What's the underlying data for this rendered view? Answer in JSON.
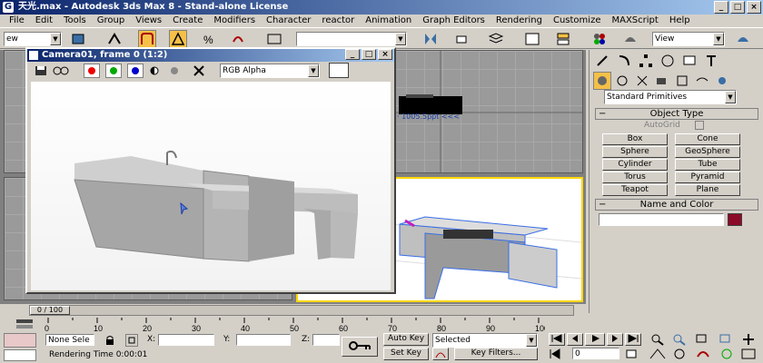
{
  "window": {
    "title": "天光.max - Autodesk 3ds Max 8 - Stand-alone License",
    "min_label": "_",
    "max_label": "□",
    "close_label": "×"
  },
  "menu": [
    "File",
    "Edit",
    "Tools",
    "Group",
    "Views",
    "Create",
    "Modifiers",
    "Character",
    "reactor",
    "Animation",
    "Graph Editors",
    "Rendering",
    "Customize",
    "MAXScript",
    "Help"
  ],
  "toolbar": {
    "selection_filter": "ew",
    "named_selection": "",
    "view_dropdown": "View"
  },
  "render_window": {
    "title": "Camera01, frame 0 (1:2)",
    "channel": "RGB Alpha"
  },
  "command_panel": {
    "category": "Standard Primitives",
    "object_type_title": "Object Type",
    "autogrid": "AutoGrid",
    "primitives": [
      "Box",
      "Cone",
      "Sphere",
      "GeoSphere",
      "Cylinder",
      "Tube",
      "Torus",
      "Pyramid",
      "Teapot",
      "Plane"
    ],
    "name_color_title": "Name and Color",
    "swatch_color": "#8b0a2a"
  },
  "timeline": {
    "slider_label": "0 / 100",
    "ticks": [
      "0",
      "10",
      "20",
      "30",
      "40",
      "50",
      "60",
      "70",
      "80",
      "90",
      "100"
    ]
  },
  "status": {
    "selection": "None Sele",
    "x_label": "X:",
    "y_label": "Y:",
    "z_label": "Z:",
    "render_time": "Rendering Time  0:00:01",
    "auto_key": "Auto Key",
    "set_key": "Set Key",
    "key_mode": "Selected",
    "key_filters": "Key Filters...",
    "frame": "0"
  },
  "viewport_text": {
    "coords": "· 1005.5ppt  <<<"
  }
}
